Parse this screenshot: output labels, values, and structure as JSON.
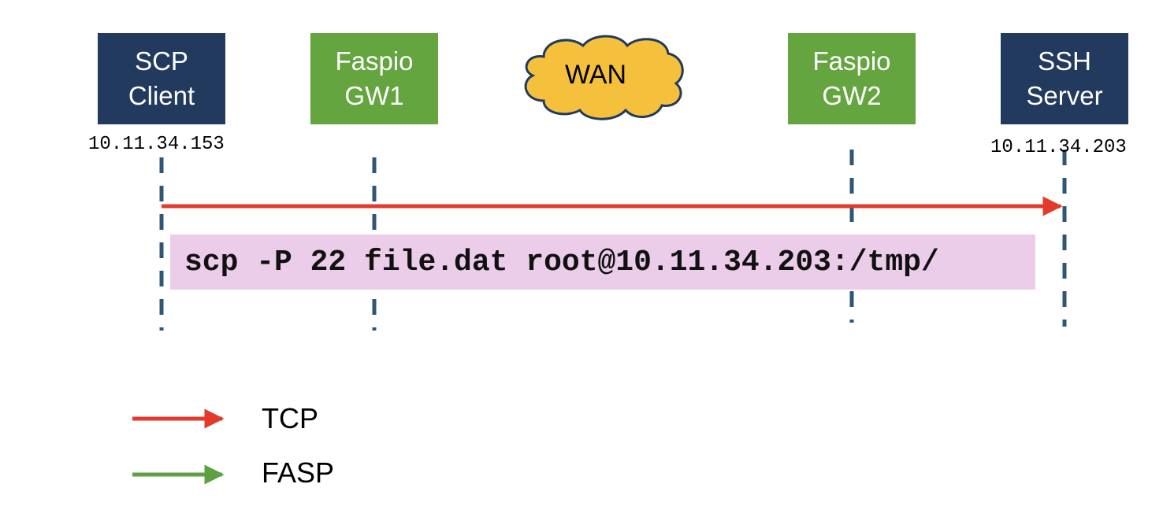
{
  "nodes": {
    "scp_client": "SCP\nClient",
    "gw1": "Faspio\nGW1",
    "wan": "WAN",
    "gw2": "Faspio\nGW2",
    "ssh_server": "SSH\nServer"
  },
  "ips": {
    "client": "10.11.34.153",
    "server": "10.11.34.203"
  },
  "command": "scp -P 22 file.dat root@10.11.34.203:/tmp/",
  "legend": {
    "tcp": "TCP",
    "fasp": "FASP"
  },
  "colors": {
    "node_dark": "#213a5e",
    "node_green": "#64a540",
    "wan_fill": "#f5c03c",
    "lifeline": "#2f5674",
    "tcp_arrow": "#e23b2c",
    "fasp_arrow": "#5fa043",
    "command_bg": "#ebcdea"
  }
}
